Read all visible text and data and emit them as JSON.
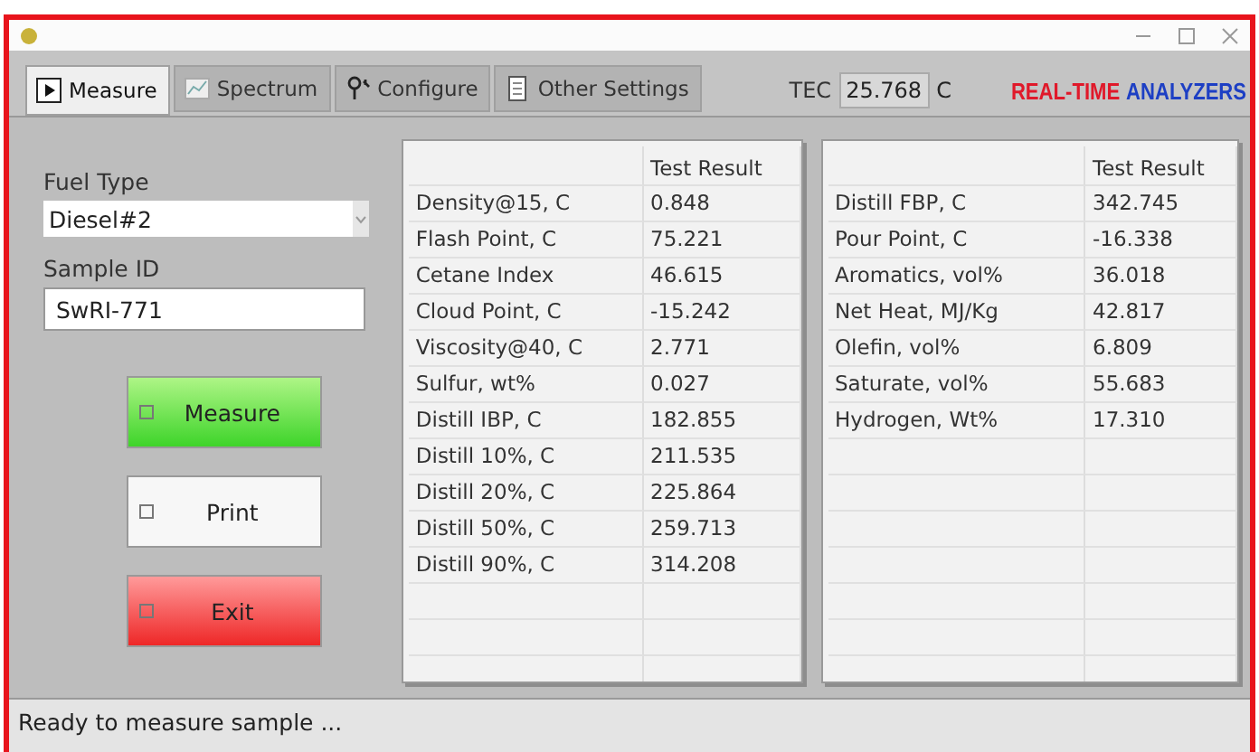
{
  "tabs": [
    {
      "label": "Measure",
      "selected": true
    },
    {
      "label": "Spectrum",
      "selected": false
    },
    {
      "label": "Configure",
      "selected": false
    },
    {
      "label": "Other Settings",
      "selected": false
    }
  ],
  "tec": {
    "label": "TEC",
    "value": "25.768",
    "unit": "C"
  },
  "brand": [
    {
      "text": "REAL-TIME",
      "color": "#e0192a"
    },
    {
      "text": "ANALYZERS",
      "color": "#1d3fc4"
    }
  ],
  "fuel_type": {
    "label": "Fuel Type",
    "value": "Diesel#2"
  },
  "sample_id": {
    "label": "Sample ID",
    "value": "SwRI-771"
  },
  "buttons": [
    {
      "label": "Measure",
      "kind": "go"
    },
    {
      "label": "Print",
      "kind": "plain"
    },
    {
      "label": "Exit",
      "kind": "stop"
    }
  ],
  "tables": [
    {
      "column": "Test Result",
      "rows": [
        {
          "name": "Density@15, C",
          "value": "0.848"
        },
        {
          "name": "Flash Point, C",
          "value": "75.221"
        },
        {
          "name": "Cetane Index",
          "value": "46.615"
        },
        {
          "name": "Cloud Point, C",
          "value": "-15.242"
        },
        {
          "name": "Viscosity@40, C",
          "value": "2.771"
        },
        {
          "name": "Sulfur, wt%",
          "value": "0.027"
        },
        {
          "name": "Distill IBP, C",
          "value": "182.855"
        },
        {
          "name": "Distill 10%, C",
          "value": "211.535"
        },
        {
          "name": "Distill 20%, C",
          "value": "225.864"
        },
        {
          "name": "Distill 50%, C",
          "value": "259.713"
        },
        {
          "name": "Distill 90%, C",
          "value": "314.208"
        }
      ]
    },
    {
      "column": "Test Result",
      "rows": [
        {
          "name": "Distill FBP, C",
          "value": "342.745"
        },
        {
          "name": "Pour Point, C",
          "value": "-16.338"
        },
        {
          "name": "Aromatics, vol%",
          "value": "36.018"
        },
        {
          "name": "Net Heat, MJ/Kg",
          "value": "42.817"
        },
        {
          "name": "Olefin, vol%",
          "value": "6.809"
        },
        {
          "name": "Saturate, vol%",
          "value": "55.683"
        },
        {
          "name": "Hydrogen, Wt%",
          "value": "17.310"
        }
      ]
    }
  ],
  "status_bar": "Ready to measure sample ..."
}
